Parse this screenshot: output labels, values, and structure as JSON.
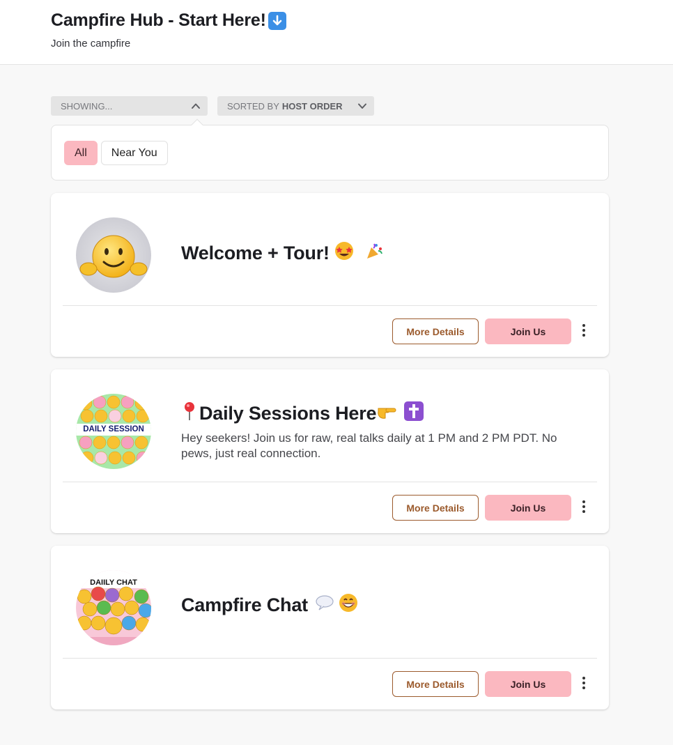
{
  "header": {
    "title": "Campfire Hub - Start Here!",
    "title_emoji": "down-arrow-icon",
    "subtitle": "Join the campfire"
  },
  "filters": {
    "showing_label": "SHOWING...",
    "sorted_prefix": "SORTED BY",
    "sorted_value": "HOST ORDER",
    "chips": [
      {
        "label": "All",
        "active": true
      },
      {
        "label": "Near You",
        "active": false
      }
    ]
  },
  "cards": [
    {
      "title": "Welcome + Tour!",
      "emojis": [
        "star-struck-emoji",
        "party-popper-emoji"
      ],
      "description": "",
      "more_label": "More Details",
      "join_label": "Join Us"
    },
    {
      "title": "Daily Sessions Here",
      "emojis": [
        "round-pushpin-emoji",
        "pointing-hand-emoji",
        "latin-cross-emoji"
      ],
      "description": "Hey seekers! Join us for raw, real talks daily at 1 PM and 2 PM PDT. No pews, just real connection.",
      "avatar_text": "DAILY SESSION",
      "more_label": "More Details",
      "join_label": "Join Us"
    },
    {
      "title": "Campfire Chat",
      "emojis": [
        "speech-balloon-emoji",
        "grinning-face-emoji"
      ],
      "description": "",
      "avatar_text": "DAIILY CHAT",
      "more_label": "More Details",
      "join_label": "Join Us"
    }
  ],
  "colors": {
    "accent_pink": "#fbb8c0",
    "details_brown": "#9b5a2c",
    "background": "#f8f8f8"
  }
}
